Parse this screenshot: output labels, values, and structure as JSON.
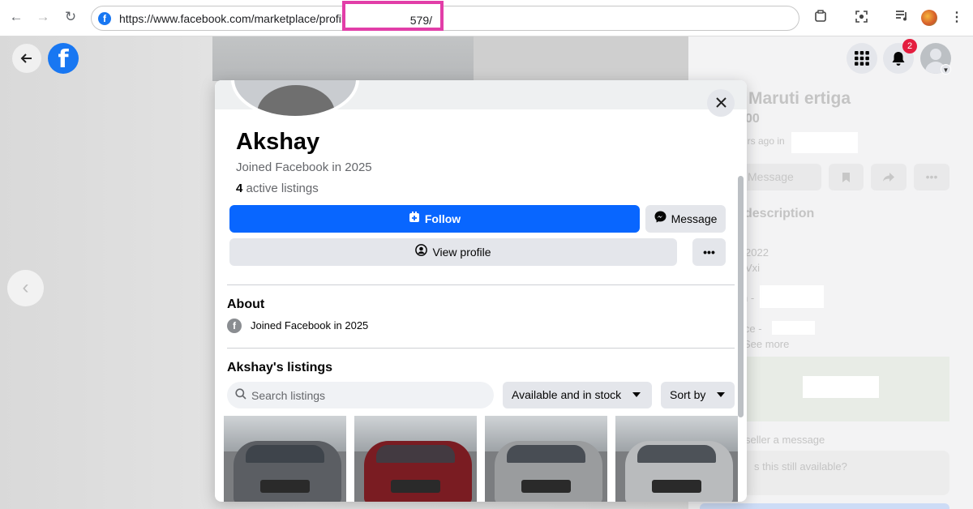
{
  "browser": {
    "url": "https://www.facebook.com/marketplace/profile/",
    "url_tail": "579/",
    "nav": {
      "back": "←",
      "forward": "→",
      "reload": "↻"
    }
  },
  "facebook_header": {
    "notifications_count": "2"
  },
  "background_listing": {
    "title": "Maruti ertiga",
    "price_fragment": "00",
    "posted_fragment": "urs ago in",
    "message_label": "Message",
    "description_heading": "description",
    "year_fragment": "2022",
    "variant_fragment": "Vxi",
    "row_a_fragment": "n -",
    "row_b_fragment": "ice -",
    "see_more": "See more",
    "send_message_fragment": "seller a message",
    "input_fragment": "s this still available?"
  },
  "modal": {
    "name": "Akshay",
    "joined": "Joined Facebook in 2025",
    "listings_count": "4",
    "listings_suffix": "active listings",
    "follow_label": "Follow",
    "message_label": "Message",
    "view_profile_label": "View profile",
    "more_label": "•••",
    "about": {
      "heading": "About",
      "joined": "Joined Facebook in 2025"
    },
    "listings": {
      "heading": "Akshay's listings",
      "search_placeholder": "Search listings",
      "filter_label": "Available and in stock",
      "sort_label": "Sort by"
    },
    "thumbnails": [
      {
        "name": "thumbnail-grey-ertiga",
        "body_color": "#5b5e63"
      },
      {
        "name": "thumbnail-red-black-car",
        "body_color": "#7a1c22"
      },
      {
        "name": "thumbnail-silver-car-side",
        "body_color": "#9a9c9e"
      },
      {
        "name": "thumbnail-silver-ignis",
        "body_color": "#b9bbbd"
      }
    ]
  }
}
